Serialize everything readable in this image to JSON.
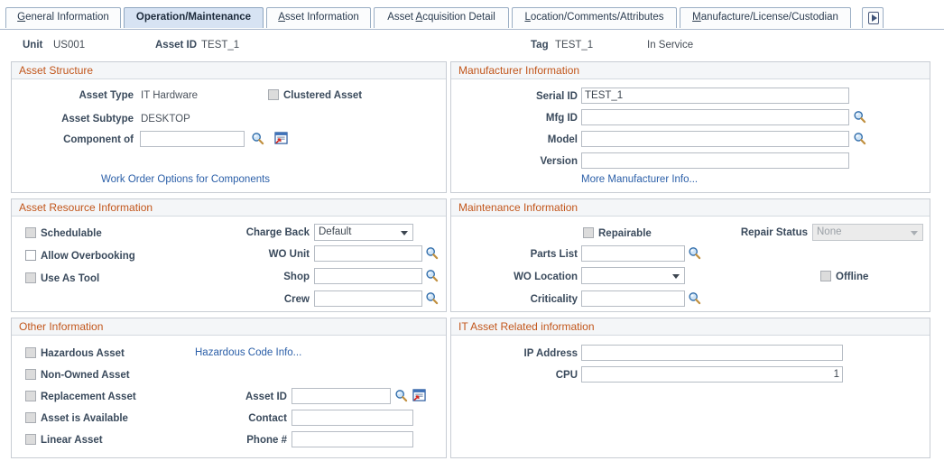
{
  "tabs": [
    {
      "label": "General Information",
      "accesskey": "G",
      "active": false
    },
    {
      "label": "Operation/Maintenance",
      "accesskey": "",
      "active": true
    },
    {
      "label": "Asset Information",
      "accesskey": "A",
      "active": false
    },
    {
      "label": "Asset Acquisition Detail",
      "accesskey": "A",
      "active": false
    },
    {
      "label": "Location/Comments/Attributes",
      "accesskey": "L",
      "active": false
    },
    {
      "label": "Manufacture/License/Custodian",
      "accesskey": "M",
      "active": false
    }
  ],
  "next_tabs_icon": "next-arrow-icon",
  "key_header": {
    "unit_label": "Unit",
    "unit_value": "US001",
    "asset_id_label": "Asset ID",
    "asset_id_value": "TEST_1",
    "tag_label": "Tag",
    "tag_value": "TEST_1",
    "status_value": "In Service"
  },
  "asset_structure": {
    "title": "Asset Structure",
    "asset_type_label": "Asset Type",
    "asset_type_value": "IT Hardware",
    "clustered_asset_label": "Clustered Asset",
    "clustered_asset_checked": false,
    "asset_subtype_label": "Asset Subtype",
    "asset_subtype_value": "DESKTOP",
    "component_of_label": "Component of",
    "component_of_value": "",
    "work_order_link": "Work Order Options for Components"
  },
  "manufacturer_information": {
    "title": "Manufacturer Information",
    "serial_id_label": "Serial ID",
    "serial_id_value": "TEST_1",
    "mfg_id_label": "Mfg ID",
    "mfg_id_value": "",
    "model_label": "Model",
    "model_value": "",
    "version_label": "Version",
    "version_value": "",
    "more_info_link": "More Manufacturer Info..."
  },
  "asset_resource_information": {
    "title": "Asset Resource Information",
    "schedulable_label": "Schedulable",
    "schedulable_checked": false,
    "allow_overbooking_label": "Allow Overbooking",
    "allow_overbooking_checked": false,
    "use_as_tool_label": "Use As Tool",
    "use_as_tool_checked": false,
    "charge_back_label": "Charge Back",
    "charge_back_value": "Default",
    "wo_unit_label": "WO Unit",
    "wo_unit_value": "",
    "shop_label": "Shop",
    "shop_value": "",
    "crew_label": "Crew",
    "crew_value": ""
  },
  "maintenance_information": {
    "title": "Maintenance Information",
    "repairable_label": "Repairable",
    "repairable_checked": false,
    "repair_status_label": "Repair Status",
    "repair_status_value": "None",
    "parts_list_label": "Parts List",
    "parts_list_value": "",
    "wo_location_label": "WO Location",
    "wo_location_value": "",
    "offline_label": "Offline",
    "offline_checked": false,
    "criticality_label": "Criticality",
    "criticality_value": ""
  },
  "other_information": {
    "title": "Other Information",
    "hazardous_asset_label": "Hazardous Asset",
    "hazardous_asset_checked": false,
    "hazardous_code_link": "Hazardous Code Info...",
    "non_owned_asset_label": "Non-Owned Asset",
    "non_owned_asset_checked": false,
    "replacement_asset_label": "Replacement Asset",
    "replacement_asset_checked": false,
    "asset_id_label": "Asset ID",
    "asset_id_value": "",
    "asset_is_available_label": "Asset is Available",
    "asset_is_available_checked": false,
    "contact_label": "Contact",
    "contact_value": "",
    "linear_asset_label": "Linear Asset",
    "linear_asset_checked": false,
    "phone_label": "Phone #",
    "phone_value": ""
  },
  "it_asset_related_information": {
    "title": "IT Asset Related information",
    "ip_address_label": "IP Address",
    "ip_address_value": "",
    "cpu_label": "CPU",
    "cpu_value": "1"
  },
  "icons": {
    "lookup": "magnifying-glass-lookup-icon",
    "transfer": "open-related-window-icon"
  },
  "colors": {
    "group_header_text": "#c2561b",
    "label_text": "#3a4a5c",
    "link": "#2b5fa8",
    "active_tab_bg": "#d7e3f3"
  }
}
